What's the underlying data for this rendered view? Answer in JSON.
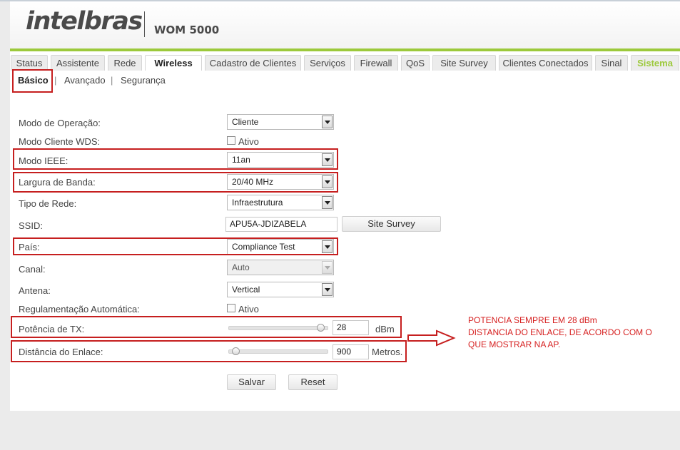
{
  "brand": {
    "logo_text": "intelbras",
    "model": "WOM 5000",
    "accent": "#9cc93b"
  },
  "tabs": [
    {
      "label": "Status",
      "active": false
    },
    {
      "label": "Assistente",
      "active": false
    },
    {
      "label": "Rede",
      "active": false
    },
    {
      "label": "Wireless",
      "active": true
    },
    {
      "label": "Cadastro de Clientes",
      "active": false
    },
    {
      "label": "Serviços",
      "active": false
    },
    {
      "label": "Firewall",
      "active": false
    },
    {
      "label": "QoS",
      "active": false
    },
    {
      "label": "Site Survey",
      "active": false
    },
    {
      "label": "Clientes Conectados",
      "active": false
    },
    {
      "label": "Sinal",
      "active": false
    },
    {
      "label": "Sistema",
      "active": false
    }
  ],
  "subnav": {
    "basico": "Básico",
    "sep": "|",
    "avancado": "Avançado",
    "seguranca": "Segurança"
  },
  "form": {
    "modo_operacao": {
      "label": "Modo de Operação:",
      "value": "Cliente"
    },
    "modo_wds": {
      "label": "Modo Cliente WDS:",
      "checkbox_label": "Ativo",
      "checked": false
    },
    "modo_ieee": {
      "label": "Modo IEEE:",
      "value": "11an"
    },
    "largura_banda": {
      "label": "Largura de Banda:",
      "value": "20/40 MHz"
    },
    "tipo_rede": {
      "label": "Tipo de Rede:",
      "value": "Infraestrutura"
    },
    "ssid": {
      "label": "SSID:",
      "value": "APU5A-JDIZABELA",
      "button": "Site Survey"
    },
    "pais": {
      "label": "País:",
      "value": "Compliance Test"
    },
    "canal": {
      "label": "Canal:",
      "value": "Auto"
    },
    "antena": {
      "label": "Antena:",
      "value": "Vertical"
    },
    "regulamentacao": {
      "label": "Regulamentação Automática:",
      "checkbox_label": "Ativo",
      "checked": false
    },
    "potencia": {
      "label": "Potência de TX:",
      "value": "28",
      "unit": "dBm",
      "slider_fraction": 0.98
    },
    "distancia": {
      "label": "Distância do Enlace:",
      "value": "900",
      "unit": "Metros.",
      "slider_fraction": 0.04
    }
  },
  "buttons": {
    "salvar": "Salvar",
    "reset": "Reset"
  },
  "annotation": {
    "color": "#c61f1f",
    "lines": [
      "POTENCIA SEMPRE EM 28 dBm",
      "DISTANCIA DO ENLACE, DE ACORDO COM O",
      "QUE MOSTRAR NA AP."
    ]
  }
}
